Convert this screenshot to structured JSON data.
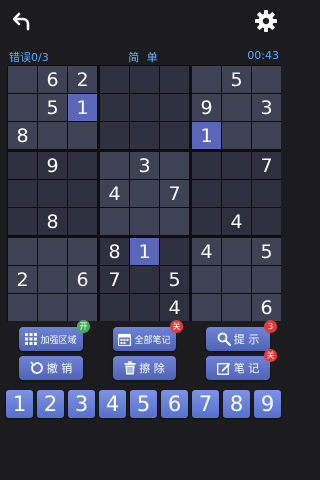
{
  "header": {
    "back_icon": "undo-arrow-icon",
    "settings_icon": "gear-icon"
  },
  "status": {
    "mistakes": "错误0/3",
    "difficulty": "简 单",
    "timer": "00:43"
  },
  "board": {
    "rows": [
      [
        "",
        "6",
        "2",
        "",
        "",
        "",
        "",
        "5",
        ""
      ],
      [
        "",
        "5",
        "1",
        "",
        "",
        "",
        "9",
        "",
        "3"
      ],
      [
        "8",
        "",
        "",
        "",
        "",
        "",
        "1",
        "",
        ""
      ],
      [
        "",
        "9",
        "",
        "",
        "3",
        "",
        "",
        "",
        "7"
      ],
      [
        "",
        "",
        "",
        "4",
        "",
        "7",
        "",
        "",
        ""
      ],
      [
        "",
        "8",
        "",
        "",
        "",
        "",
        "",
        "4",
        ""
      ],
      [
        "",
        "",
        "",
        "8",
        "1",
        "",
        "4",
        "",
        "5"
      ],
      [
        "2",
        "",
        "6",
        "7",
        "",
        "5",
        "",
        "",
        ""
      ],
      [
        "",
        "",
        "",
        "",
        "",
        "4",
        "",
        "",
        "6"
      ]
    ],
    "selected_value": "1",
    "colors": {
      "cell": "#3f4254",
      "cell_alt": "#2e3040",
      "highlight": "#4d5aa6",
      "selected": "#5a66b8"
    }
  },
  "actions": {
    "highlight_area": {
      "label": "加强区域",
      "icon": "grid-icon",
      "badge": "开"
    },
    "all_notes": {
      "label": "全部笔记",
      "icon": "calendar-icon",
      "badge": "关"
    },
    "hint": {
      "label": "提 示",
      "icon": "magnifier-icon",
      "badge": "3"
    },
    "undo": {
      "label": "撤 销",
      "icon": "rotate-icon"
    },
    "erase": {
      "label": "擦 除",
      "icon": "trash-icon"
    },
    "notes": {
      "label": "笔 记",
      "icon": "pencil-icon",
      "badge": "关"
    }
  },
  "numpad": [
    "1",
    "2",
    "3",
    "4",
    "5",
    "6",
    "7",
    "8",
    "9"
  ]
}
